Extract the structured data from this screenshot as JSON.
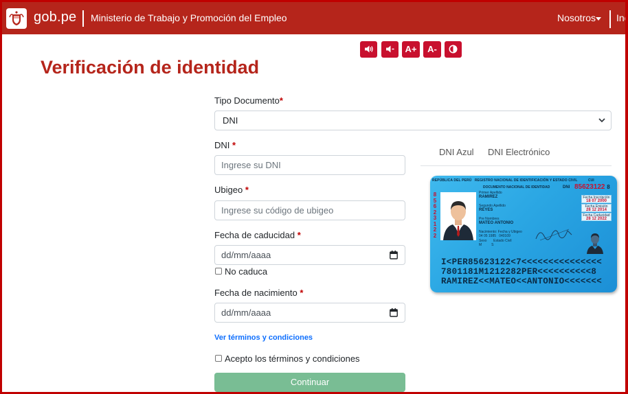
{
  "navbar": {
    "brand": "gob.pe",
    "ministry": "Ministerio de Trabajo y Promoción del Empleo",
    "nosotros": "Nosotros",
    "more": "Inc"
  },
  "accessibility": {
    "increase_font": "A+",
    "decrease_font": "A-"
  },
  "page": {
    "title": "Verificación de identidad"
  },
  "form": {
    "tipo_documento": {
      "label": "Tipo Documento",
      "required": "*",
      "value": "DNI"
    },
    "dni": {
      "label": "DNI",
      "required": "*",
      "placeholder": "Ingrese su DNI"
    },
    "ubigeo": {
      "label": "Ubigeo",
      "required": "*",
      "placeholder": "Ingrese su código de ubigeo"
    },
    "fecha_caducidad": {
      "label": "Fecha de caducidad",
      "required": "*",
      "placeholder": "dd/mm/aaaa"
    },
    "no_caduca": "No caduca",
    "fecha_nacimiento": {
      "label": "Fecha de nacimiento",
      "required": "*",
      "placeholder": "dd/mm/aaaa"
    },
    "terms_link": "Ver términos y condiciones",
    "accept_terms": "Acepto los términos y condiciones",
    "submit": "Continuar"
  },
  "tabs": [
    "DNI Azul",
    "DNI Electrónico"
  ],
  "id_card": {
    "country": "REPÚBLICA DEL PERÚ",
    "registry": "REGISTRO NACIONAL DE IDENTIFICACIÓN Y ESTADO CIVIL",
    "document_name": "DOCUMENTO NACIONAL DE IDENTIDAD",
    "dni_label": "DNI",
    "cui_label": "CUI",
    "number": "85623122",
    "check_digit": "8",
    "vertical_number": "85623122",
    "primer_apellido_label": "Primer Apellido",
    "primer_apellido": "RAMIREZ",
    "segundo_apellido_label": "Segundo Apellido",
    "segundo_apellido": "REYES",
    "prenombres_label": "Pre Nombres",
    "prenombres": "MATEO ANTONIO",
    "nacimiento_label": "Nacimiento:",
    "nacimiento_value": "04 05 1985",
    "ubigeo_label": "Fecha y Ubigeo",
    "ubigeo_value": "040109",
    "sexo_label": "Sexo",
    "sexo_value": "M",
    "estado_civil_label": "Estado Civil",
    "estado_civil_value": "S",
    "fecha_inscripcion_label": "Fecha Inscripción",
    "fecha_inscripcion": "18 07 2000",
    "fecha_emision_label": "Fecha Emisión",
    "fecha_emision": "28 12 2014",
    "fecha_caducidad_label": "Fecha Caducidad",
    "fecha_caducidad": "28 12 2022",
    "mrz": [
      "I<PER85623122<7<<<<<<<<<<<<<<<",
      "7801181M1212282PER<<<<<<<<<<8",
      "RAMIREZ<<MATEO<<ANTONIO<<<<<<<"
    ]
  },
  "colors": {
    "navbar": "#b5251b",
    "title": "#b5251b",
    "accessibility_buttons": "#c8102e",
    "submit_button": "#79bd94",
    "link": "#0d6efd",
    "card": "#2aa6e3"
  }
}
